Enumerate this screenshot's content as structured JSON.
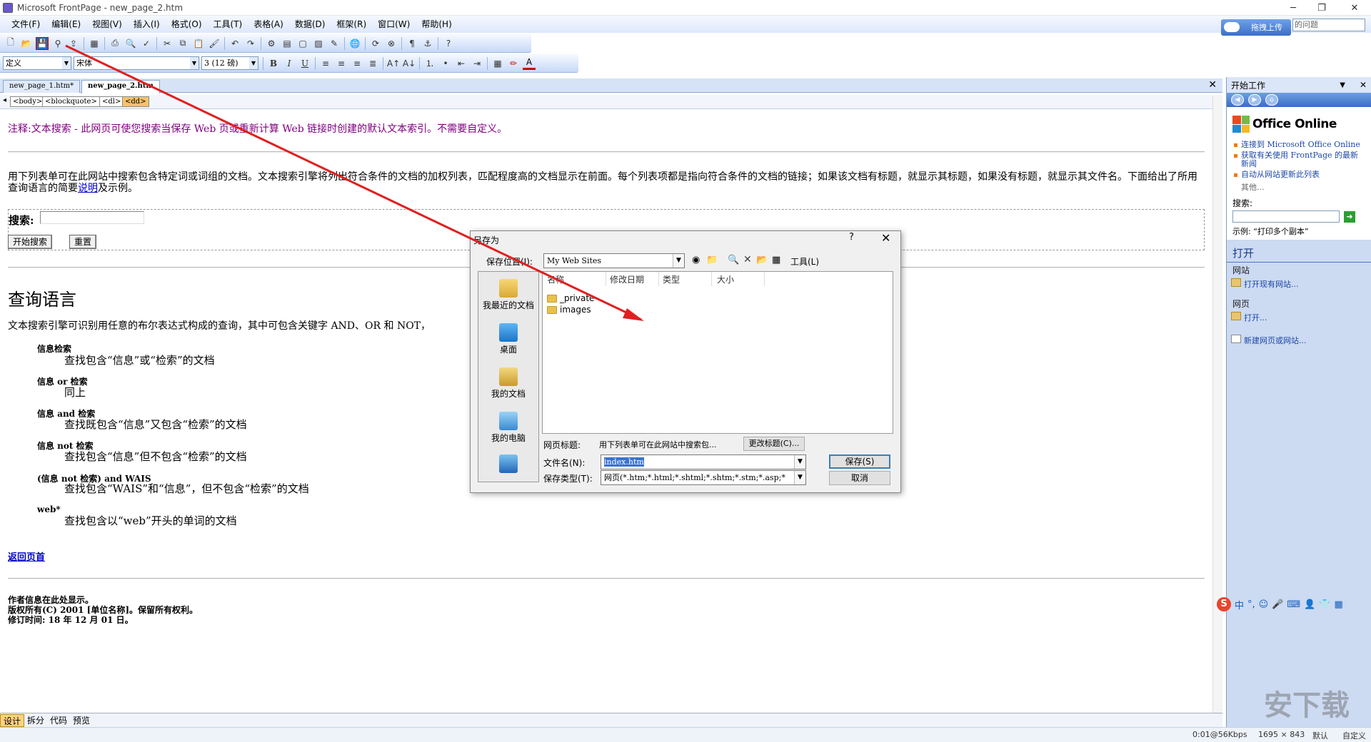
{
  "window": {
    "title": "Microsoft FrontPage - new_page_2.htm",
    "minimize": "─",
    "restore": "❐",
    "close": "✕"
  },
  "menu": [
    "文件(F)",
    "编辑(E)",
    "视图(V)",
    "插入(I)",
    "格式(O)",
    "工具(T)",
    "表格(A)",
    "数据(D)",
    "框架(R)",
    "窗口(W)",
    "帮助(H)"
  ],
  "ask": {
    "button": "拖拽上传",
    "placeholder": "的问题"
  },
  "format_toolbar": {
    "style": "定义",
    "font": "宋体",
    "size": "3 (12 磅)"
  },
  "doc_tabs": [
    "new_page_1.htm*",
    "new_page_2.htm"
  ],
  "tags": [
    "<body>",
    "<blockquote>",
    "<dl>",
    "<dd>"
  ],
  "page": {
    "note": "注释:文本搜索 - 此网页可使您搜索当保存 Web 页或重新计算 Web 链接时创建的默认文本索引。不需要自定义。",
    "para_1": "用下列表单可在此网站中搜索包含特定词或词组的文档。文本搜索引擎将列出符合条件的文档的加权列表，匹配程度高的文档显示在前面。每个列表项都是指向符合条件的文档的链接；如果该文档有标题，就显示其标题，如果没有标题，就显示其文件名。下面给出了所用查询语言的简要",
    "para_link": "说明",
    "para_2": "及示例。",
    "search_label": "搜索:",
    "start_search": "开始搜索",
    "reset": "重置",
    "heading": "查询语言",
    "desc": "文本搜索引擎可识别用任意的布尔表达式构成的查询，其中可包含关键字 AND、OR 和 NOT，",
    "queries": [
      {
        "term": "信息检索",
        "desc": "查找包含“信息”或“检索”的文档"
      },
      {
        "term": "信息 or 检索",
        "desc": "同上"
      },
      {
        "term": "信息 and 检索",
        "desc": "查找既包含“信息”又包含“检索”的文档"
      },
      {
        "term": "信息 not 检索",
        "desc": "查找包含“信息”但不包含“检索”的文档"
      },
      {
        "term": "(信息 not 检索) and WAIS",
        "desc": "查找包含“WAIS”和“信息”，但不包含“检索”的文档"
      },
      {
        "term": "web*",
        "desc": "查找包含以“web”开头的单词的文档"
      }
    ],
    "back": "返回页首",
    "footer": [
      "作者信息在此处显示。",
      "版权所有(C) 2001 [单位名称]。保留所有权利。",
      "修订时间: 18 年 12 月 01 日。"
    ]
  },
  "view_tabs": [
    "设计",
    "拆分",
    "代码",
    "预览"
  ],
  "status": {
    "speed": "0:01@56Kbps",
    "size": "1695 × 843",
    "mode1": "默认",
    "mode2": "自定义"
  },
  "taskpane": {
    "title": "开始工作",
    "logo": "Office Online",
    "links": [
      "连接到 Microsoft Office Online",
      "获取有关使用 FrontPage 的最新新闻",
      "自动从网站更新此列表"
    ],
    "more": "其他...",
    "search_label": "搜索:",
    "example": "示例: “打印多个副本”",
    "open_section": "打开",
    "site_label": "网站",
    "open_site": "打开现有网站...",
    "page_label": "网页",
    "open_page": "打开...",
    "new_page": "新建网页或网站..."
  },
  "dialog": {
    "title": "另存为",
    "help": "?",
    "close": "✕",
    "save_in_label": "保存位置(I):",
    "save_in": "My Web Sites",
    "tools": "工具(L)",
    "places": [
      "我最近的文档",
      "桌面",
      "我的文档",
      "我的电脑"
    ],
    "columns": [
      "名称",
      "修改日期",
      "类型",
      "大小"
    ],
    "files": [
      "_private",
      "images"
    ],
    "page_title_label": "网页标题:",
    "page_title": "用下列表单可在此网站中搜索包...",
    "change_title": "更改标题(C)...",
    "filename_label": "文件名(N):",
    "filename": "index.htm",
    "filetype_label": "保存类型(T):",
    "filetype": "网页(*.htm;*.html;*.shtml;*.shtm;*.stm;*.asp;*",
    "save": "保存(S)",
    "cancel": "取消"
  },
  "ime": [
    "中",
    "°,"
  ],
  "watermark": "安下载"
}
